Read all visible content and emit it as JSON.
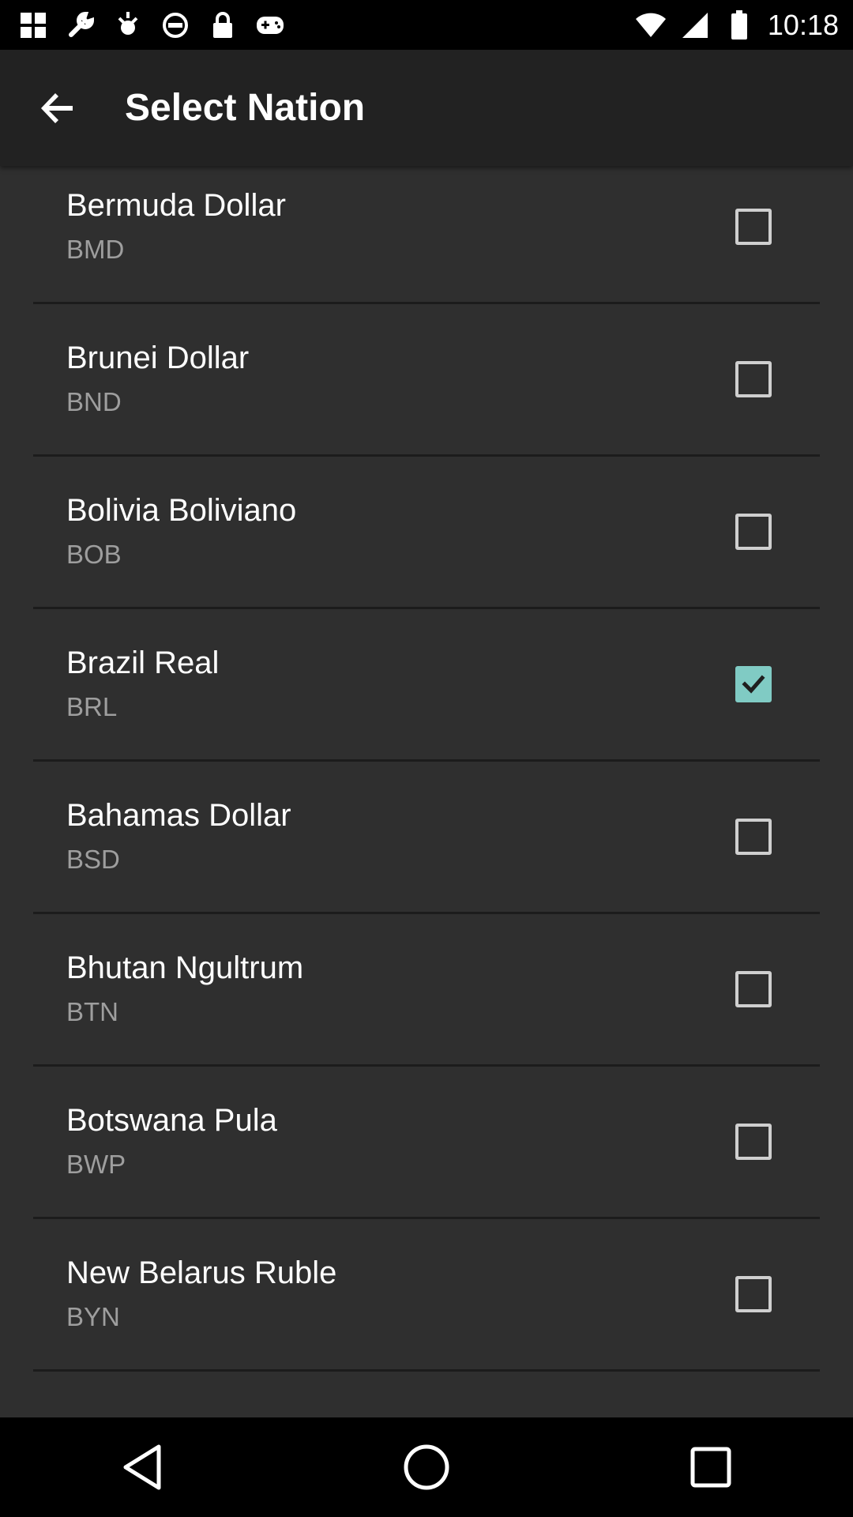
{
  "status_bar": {
    "time": "10:18",
    "left_icons": [
      "grid-icon",
      "wrench-icon",
      "fake-gps-icon",
      "no-disturb-icon",
      "lock-icon",
      "game-controller-icon"
    ],
    "right_icons": [
      "wifi-icon",
      "signal-icon",
      "battery-icon"
    ]
  },
  "app_bar": {
    "title": "Select Nation",
    "back_icon": "arrow-back-icon"
  },
  "currencies": [
    {
      "name": "Bermuda Dollar",
      "code": "BMD",
      "checked": false
    },
    {
      "name": "Brunei Dollar",
      "code": "BND",
      "checked": false
    },
    {
      "name": "Bolivia Boliviano",
      "code": "BOB",
      "checked": false
    },
    {
      "name": "Brazil Real",
      "code": "BRL",
      "checked": true
    },
    {
      "name": "Bahamas Dollar",
      "code": "BSD",
      "checked": false
    },
    {
      "name": "Bhutan Ngultrum",
      "code": "BTN",
      "checked": false
    },
    {
      "name": "Botswana Pula",
      "code": "BWP",
      "checked": false
    },
    {
      "name": "New Belarus Ruble",
      "code": "BYN",
      "checked": false
    }
  ],
  "colors": {
    "background": "#2f2f2f",
    "app_bar": "#222222",
    "accent": "#80cbc4"
  },
  "nav_bar": {
    "buttons": [
      "back-triangle-icon",
      "home-circle-icon",
      "recents-square-icon"
    ]
  }
}
